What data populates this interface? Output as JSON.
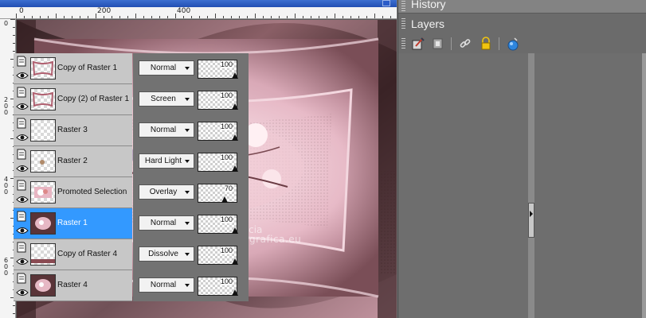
{
  "ruler": {
    "h_labels": [
      "200",
      "400"
    ],
    "v_labels": [
      "0",
      "200",
      "400",
      "600"
    ]
  },
  "canvas": {
    "watermark_line1": "Pinuccia",
    "watermark_line2": "www.maidiregrafica.eu"
  },
  "panels": {
    "history_title": "History",
    "layers_title": "Layers"
  },
  "toolbar_icons": [
    "new-raster-layer-icon",
    "new-mask-layer-icon",
    "link-layers-icon",
    "lock-transparency-icon",
    "layer-styles-icon"
  ],
  "layers": [
    {
      "name": "Copy of Raster 1",
      "blend": "Normal",
      "opacity": 100,
      "selected": false,
      "thumb": "frame"
    },
    {
      "name": "Copy (2) of Raster 1",
      "blend": "Screen",
      "opacity": 100,
      "selected": false,
      "thumb": "frame"
    },
    {
      "name": "Raster 3",
      "blend": "Normal",
      "opacity": 100,
      "selected": false,
      "thumb": "empty"
    },
    {
      "name": "Raster 2",
      "blend": "Hard Light",
      "opacity": 100,
      "selected": false,
      "thumb": "dot"
    },
    {
      "name": "Promoted Selection",
      "blend": "Overlay",
      "opacity": 70,
      "selected": false,
      "thumb": "flower"
    },
    {
      "name": "Raster 1",
      "blend": "Normal",
      "opacity": 100,
      "selected": true,
      "thumb": "picture"
    },
    {
      "name": "Copy of Raster 4",
      "blend": "Dissolve",
      "opacity": 100,
      "selected": false,
      "thumb": "strip"
    },
    {
      "name": "Raster 4",
      "blend": "Normal",
      "opacity": 100,
      "selected": false,
      "thumb": "picture"
    }
  ],
  "colors": {
    "selection": "#3399ff",
    "canvas_pink": "#e8b8c8",
    "canvas_dark": "#4a2a2c"
  }
}
